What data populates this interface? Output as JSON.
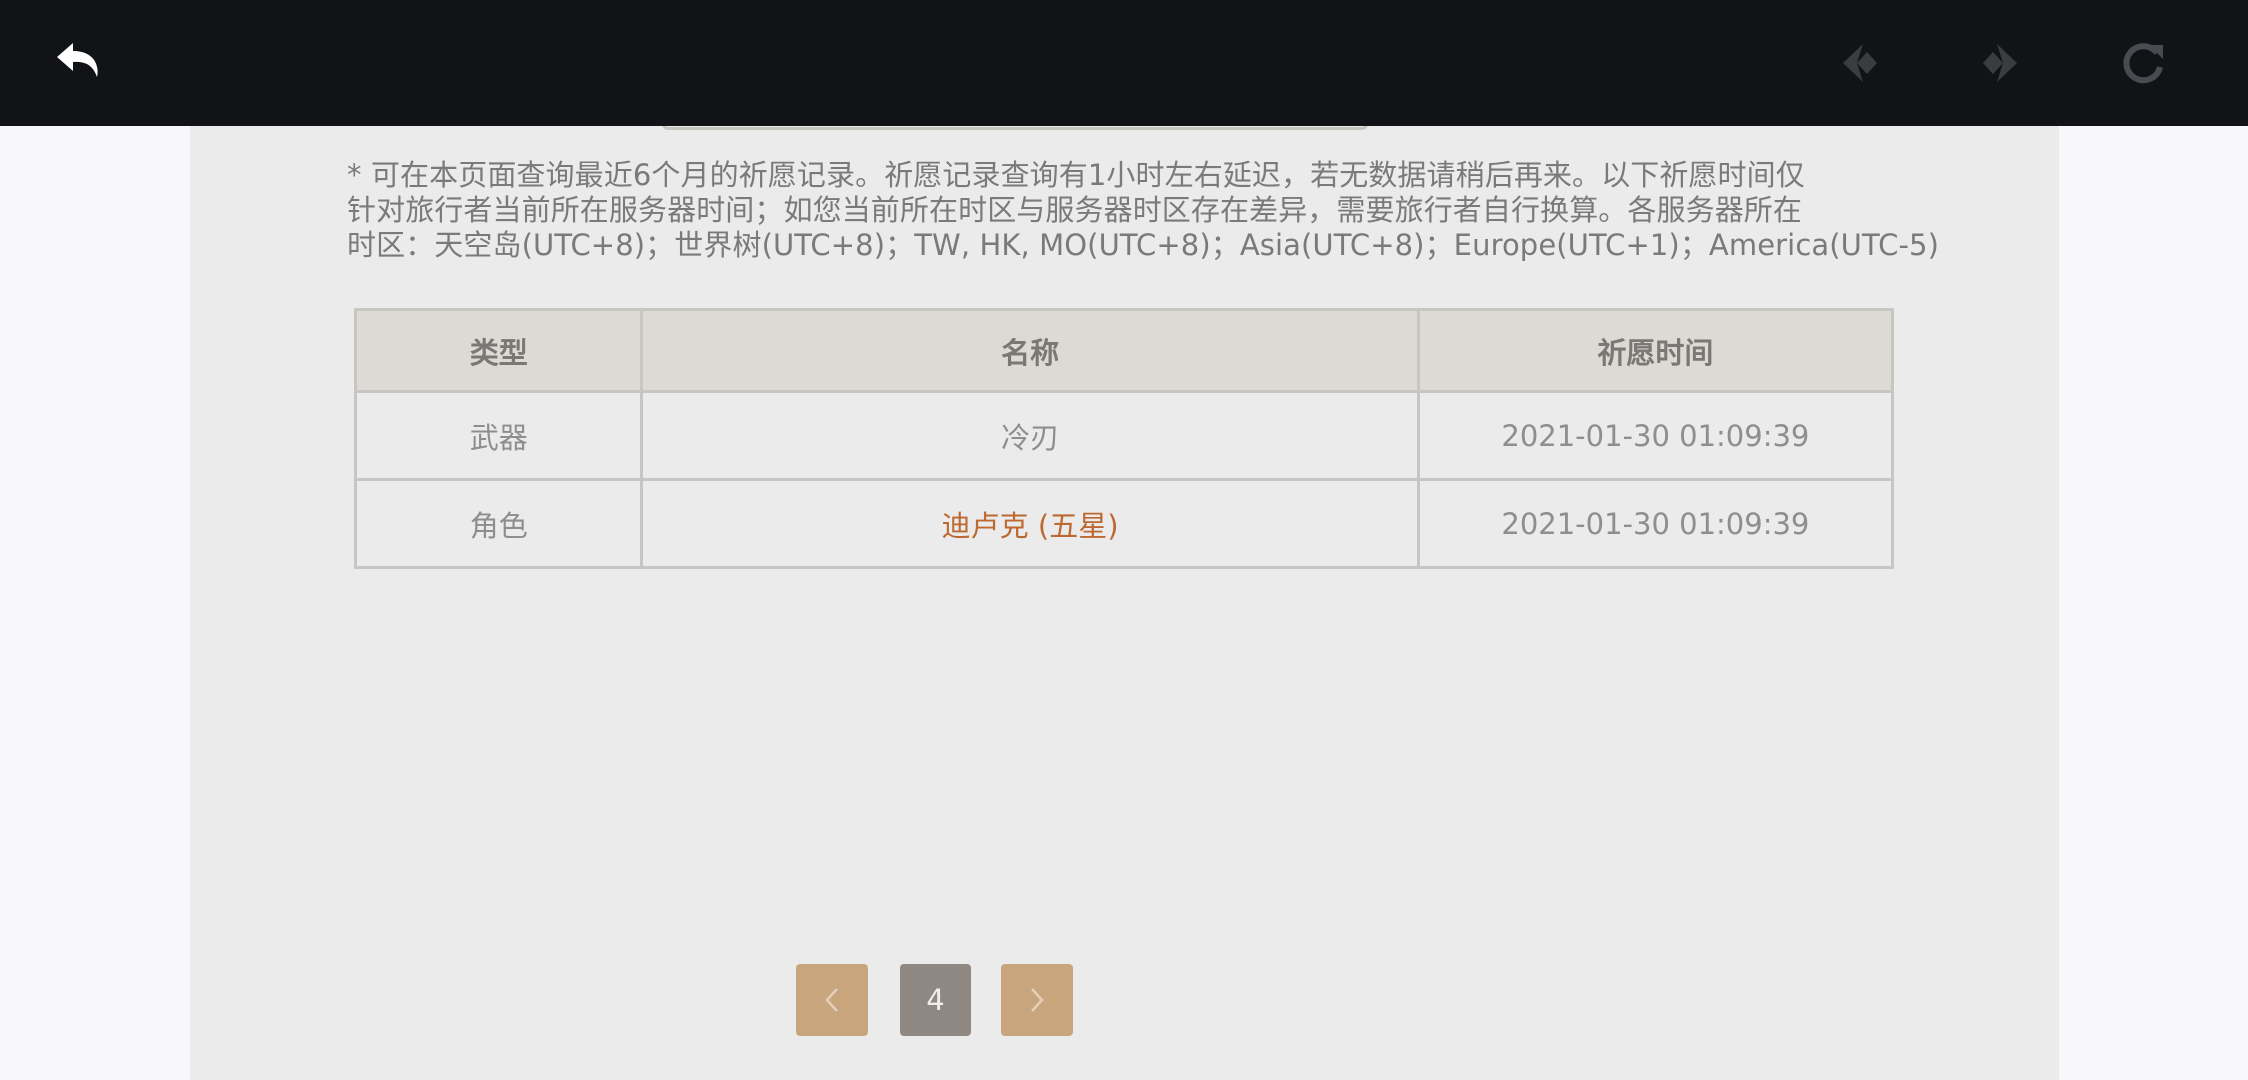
{
  "header": {
    "back_icon": "undo-arrow-icon",
    "prev_icon": "prev-diamond-icon",
    "next_icon": "next-diamond-icon",
    "refresh_icon": "refresh-icon"
  },
  "notice": {
    "lines": [
      "* 可在本页面查询最近6个月的祈愿记录。祈愿记录查询有1小时左右延迟，若无数据请稍后再来。以下祈愿时间仅",
      "针对旅行者当前所在服务器时间；如您当前所在时区与服务器时区存在差异，需要旅行者自行换算。各服务器所在",
      "时区：天空岛(UTC+8)；世界树(UTC+8)；TW, HK, MO(UTC+8)；Asia(UTC+8)；Europe(UTC+1)；America(UTC-5)"
    ]
  },
  "table": {
    "headers": [
      "类型",
      "名称",
      "祈愿时间"
    ],
    "rows": [
      {
        "type": "武器",
        "name": "冷刃",
        "time": "2021-01-30 01:09:39"
      },
      {
        "type": "角色",
        "name": "迪卢克 (五星)",
        "time": "2021-01-30 01:09:39"
      }
    ]
  },
  "pagination": {
    "current_page": "4",
    "prev_icon": "chevron-left-icon",
    "next_icon": "chevron-right-icon"
  },
  "colors": {
    "topbar": "#121316",
    "panel": "#ebebeb",
    "five_star": "#bd6932",
    "pager_button": "#c9a57e",
    "pager_current": "#8f8781"
  }
}
